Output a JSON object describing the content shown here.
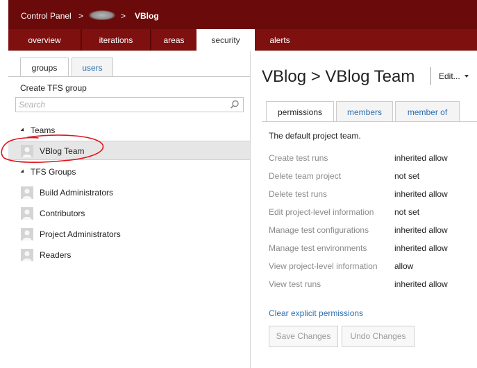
{
  "header": {
    "breadcrumb_root": "Control Panel",
    "separator": ">",
    "project": "VBlog"
  },
  "nav_tabs": [
    {
      "label": "overview",
      "active": false
    },
    {
      "label": "iterations",
      "active": false
    },
    {
      "label": "areas",
      "active": false
    },
    {
      "label": "security",
      "active": true
    },
    {
      "label": "alerts",
      "active": false
    }
  ],
  "left": {
    "tabs": [
      {
        "label": "groups",
        "active": true
      },
      {
        "label": "users",
        "active": false
      }
    ],
    "create_group": "Create TFS group",
    "search_placeholder": "Search",
    "teams_heading": "Teams",
    "teams": [
      {
        "label": "VBlog Team",
        "selected": true
      }
    ],
    "groups_heading": "TFS Groups",
    "groups": [
      {
        "label": "Build Administrators"
      },
      {
        "label": "Contributors"
      },
      {
        "label": "Project Administrators"
      },
      {
        "label": "Readers"
      }
    ]
  },
  "right": {
    "title": "VBlog > VBlog Team",
    "edit_menu": "Edit...",
    "tabs": [
      {
        "label": "permissions",
        "active": true
      },
      {
        "label": "members",
        "active": false
      },
      {
        "label": "member of",
        "active": false
      }
    ],
    "description": "The default project team.",
    "permissions": [
      {
        "name": "Create test runs",
        "value": "inherited allow"
      },
      {
        "name": "Delete team project",
        "value": "not set"
      },
      {
        "name": "Delete test runs",
        "value": "inherited allow"
      },
      {
        "name": "Edit project-level information",
        "value": "not set"
      },
      {
        "name": "Manage test configurations",
        "value": "inherited allow"
      },
      {
        "name": "Manage test environments",
        "value": "inherited allow"
      },
      {
        "name": "View project-level information",
        "value": "allow"
      },
      {
        "name": "View test runs",
        "value": "inherited allow"
      }
    ],
    "clear_link": "Clear explicit permissions",
    "save_button": "Save Changes",
    "undo_button": "Undo Changes"
  },
  "colors": {
    "header_bg": "#6a0a0a",
    "tabbar_bg": "#7f1010",
    "link": "#2f6fb0",
    "annotation": "#e0141e"
  }
}
